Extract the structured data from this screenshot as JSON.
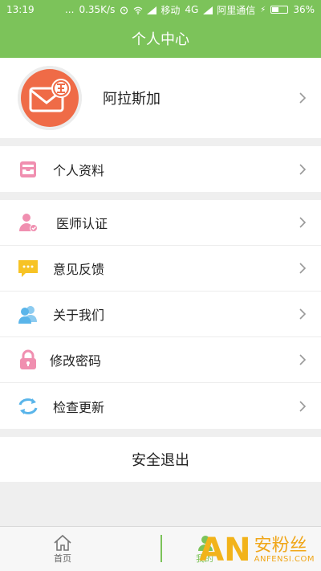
{
  "status_bar": {
    "time": "13:19",
    "dots": "...",
    "speed": "0.35K/s",
    "carrier1": "移动",
    "network": "4G",
    "carrier2": "阿里通信",
    "battery": "36%",
    "battery_level": 0.36
  },
  "header": {
    "title": "个人中心"
  },
  "profile": {
    "name": "阿拉斯加",
    "avatar_icon": "mail-logo-avatar"
  },
  "menu_group1": [
    {
      "label": "个人资料",
      "icon": "inbox-icon"
    }
  ],
  "menu_group2": [
    {
      "label": "医师认证",
      "icon": "user-check-icon"
    },
    {
      "label": "意见反馈",
      "icon": "chat-bubble-icon"
    },
    {
      "label": "关于我们",
      "icon": "users-icon"
    },
    {
      "label": "修改密码",
      "icon": "lock-icon"
    },
    {
      "label": "检查更新",
      "icon": "refresh-icon"
    }
  ],
  "logout_label": "安全退出",
  "tabbar": {
    "home_label": "首页",
    "mine_label": "我的"
  },
  "watermark": {
    "letters": "AN",
    "cn": "安粉丝",
    "en": "ANFENSI.COM"
  },
  "colors": {
    "accent": "#7cc35a",
    "pink": "#f08fb0",
    "yellow": "#f7c325",
    "blue": "#5ab5ea",
    "orange": "#f2b31a"
  }
}
